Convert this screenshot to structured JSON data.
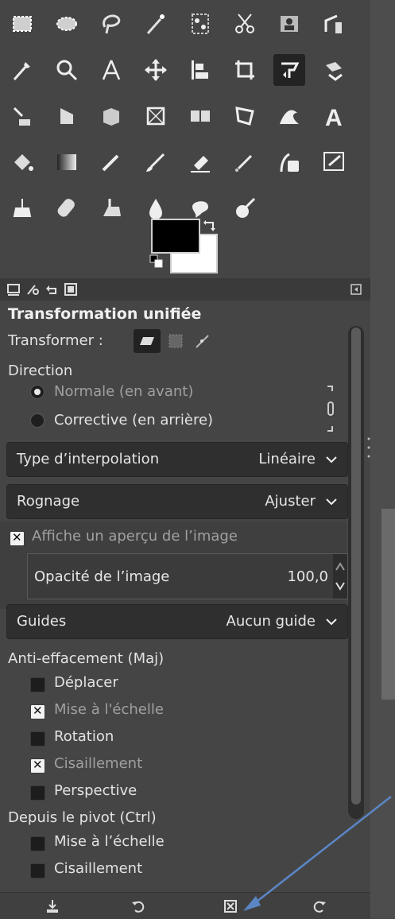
{
  "tool_options": {
    "title": "Transformation unifiée",
    "transform_label": "Transformer :",
    "direction_label": "Direction",
    "direction_options": [
      "Normale (en avant)",
      "Corrective (en arrière)"
    ],
    "interpolation": {
      "label": "Type d’interpolation",
      "value": "Linéaire"
    },
    "clipping": {
      "label": "Rognage",
      "value": "Ajuster"
    },
    "show_preview": {
      "label": "Affiche un aperçu de l’image",
      "checked": true
    },
    "image_opacity": {
      "label": "Opacité de l’image",
      "value": "100,0"
    },
    "guides": {
      "label": "Guides",
      "value": "Aucun guide"
    },
    "constrain_label": "Anti-effacement (Maj)",
    "constrain_items": [
      {
        "label": "Déplacer",
        "checked": false
      },
      {
        "label": "Mise à l'échelle",
        "checked": true
      },
      {
        "label": "Rotation",
        "checked": false
      },
      {
        "label": "Cisaillement",
        "checked": true
      },
      {
        "label": "Perspective",
        "checked": false
      }
    ],
    "pivot_label": "Depuis le pivot  (Ctrl)",
    "pivot_items": [
      {
        "label": "Mise à l’échelle",
        "checked": false
      },
      {
        "label": "Cisaillement",
        "checked": false
      }
    ]
  },
  "colors": {
    "foreground": "#000000",
    "background": "#ffffff",
    "accent_arrow": "#5b86c5"
  }
}
